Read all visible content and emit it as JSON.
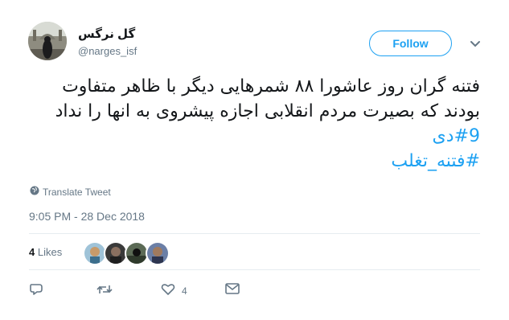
{
  "user": {
    "display_name": "گل نرگس",
    "handle": "@narges_isf",
    "follow_label": "Follow"
  },
  "tweet": {
    "lines": [
      "فتنه گران روز عاشورا ۸۸ شمرهایی دیگر با ظاهر متفاوت",
      "بودند که بصیرت مردم انقلابی اجازه پیشروی به انها را نداد"
    ],
    "hashtags": [
      "#9دی",
      "#فتنه_تغلب"
    ]
  },
  "translate_label": "Translate Tweet",
  "timestamp": "9:05 PM - 28 Dec 2018",
  "likes": {
    "count": "4",
    "label": "Likes"
  },
  "actions": {
    "like_count": "4"
  },
  "colors": {
    "accent": "#1da1f2",
    "muted": "#657786",
    "text": "#14171a"
  }
}
